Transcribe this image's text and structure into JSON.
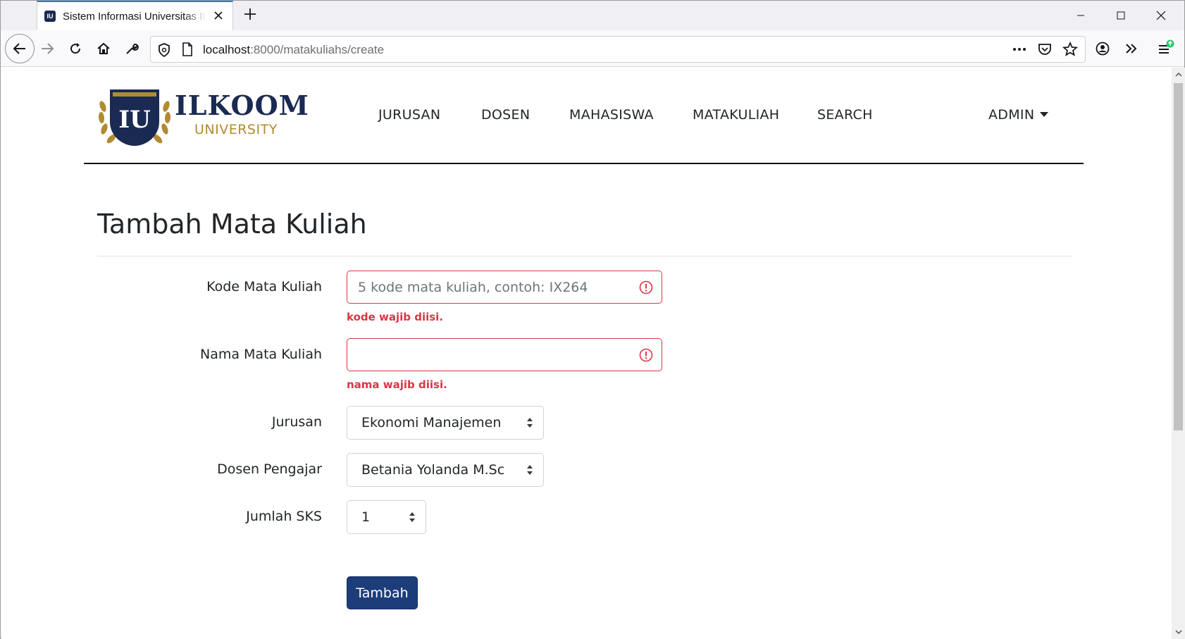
{
  "browser": {
    "tab_title": "Sistem Informasi Universitas ILKOOM",
    "tab_favicon": "IU",
    "url_host": "localhost",
    "url_path": ":8000/matakuliahs/create"
  },
  "brand": {
    "word": "ILKOOM",
    "sub": "UNIVERSITY",
    "emblem": "IU",
    "navy": "#1b2a52",
    "gold": "#b08b2f"
  },
  "nav": {
    "jurusan": "JURUSAN",
    "dosen": "DOSEN",
    "mahasiswa": "MAHASISWA",
    "matakuliah": "MATAKULIAH",
    "search": "SEARCH",
    "admin": "ADMIN"
  },
  "page": {
    "title": "Tambah Mata Kuliah"
  },
  "form": {
    "kode": {
      "label": "Kode Mata Kuliah",
      "placeholder": "5 kode mata kuliah, contoh: IX264",
      "value": "",
      "error": "kode wajib diisi."
    },
    "nama": {
      "label": "Nama Mata Kuliah",
      "placeholder": "",
      "value": "",
      "error": "nama wajib diisi."
    },
    "jurusan": {
      "label": "Jurusan",
      "selected": "Ekonomi Manajemen"
    },
    "dosen": {
      "label": "Dosen Pengajar",
      "selected": "Betania Yolanda M.Sc"
    },
    "sks": {
      "label": "Jumlah SKS",
      "selected": "1"
    },
    "submit_label": "Tambah"
  },
  "colors": {
    "error": "#dc3545",
    "primary": "#1c3d7a",
    "browser_accent": "#0a84ff"
  }
}
